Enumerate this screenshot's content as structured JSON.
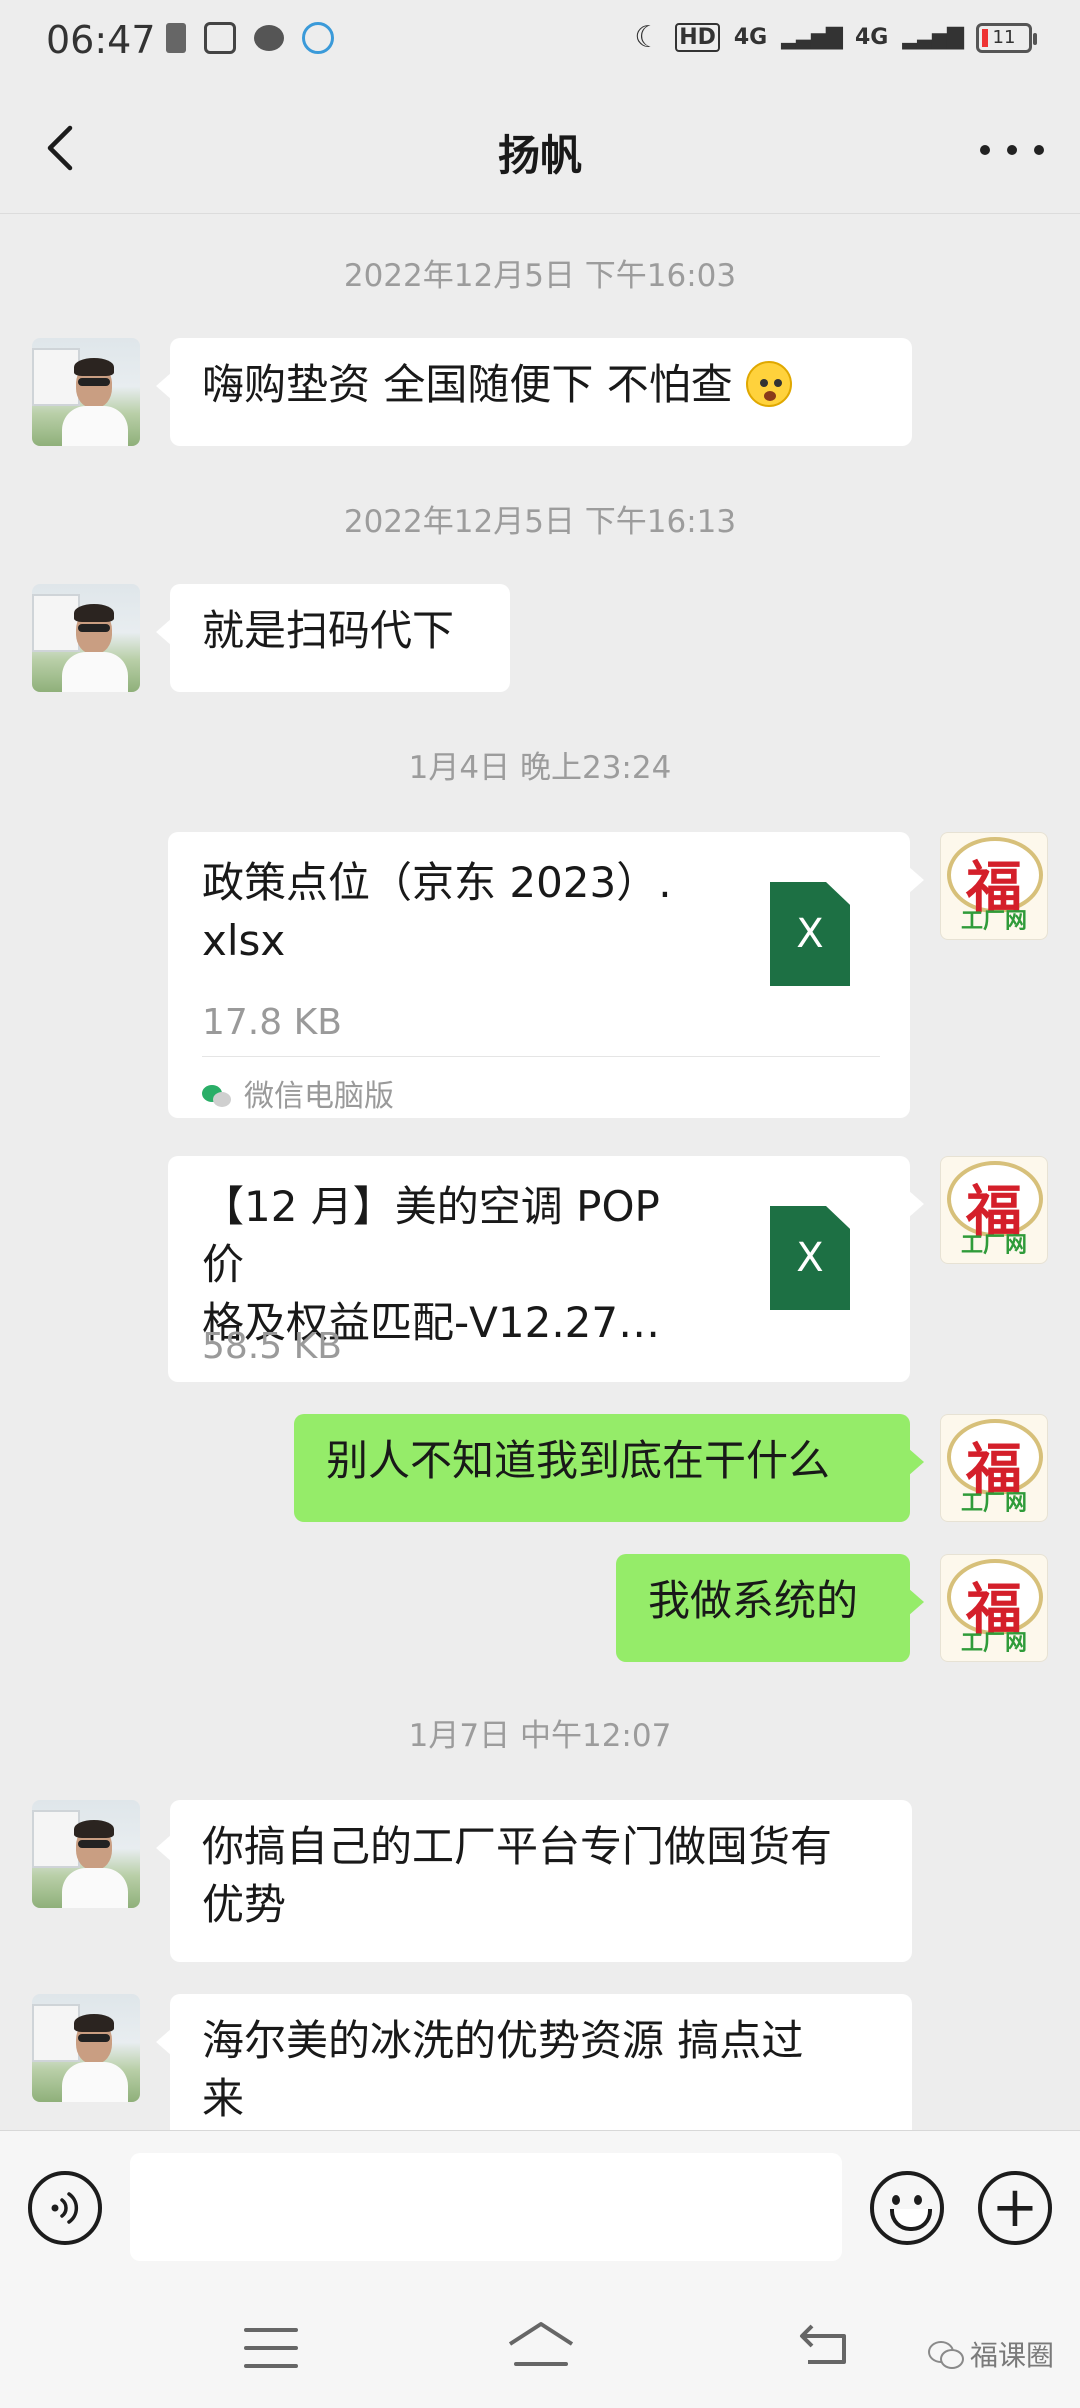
{
  "status_bar": {
    "time": "06:47",
    "hd_label": "HD",
    "network_1": "4G",
    "network_2": "4G",
    "battery": "11"
  },
  "header": {
    "title": "扬帆",
    "back_icon": "chevron-left-icon",
    "more_icon": "more-dots-icon"
  },
  "messages": {
    "ts_1": "2022年12月5日  下午16:03",
    "m1_text": "嗨购垫资  全国随便下  不怕查",
    "ts_2": "2022年12月5日  下午16:13",
    "m2_text": "就是扫码代下",
    "ts_3": "1月4日  晚上23:24",
    "file1": {
      "name_line1": "政策点位（京东 2023）.",
      "name_line2": "xlsx",
      "size": "17.8  KB",
      "icon_letter": "X",
      "source": "微信电脑版"
    },
    "file2": {
      "name_line1": "【12 月】美的空调 POP 价",
      "name_line2": "格及权益匹配-V12.27…",
      "size": "58.5  KB",
      "icon_letter": "X"
    },
    "m5_text": "别人不知道我到底在干什么",
    "m6_text": "我做系统的",
    "ts_4": "1月7日  中午12:07",
    "m7_line1": "你搞自己的工厂平台专门做囤货有",
    "m7_line2": "优势",
    "m8_line1": "海尔美的冰洗的优势资源  搞点过",
    "m8_line2": "来"
  },
  "avatar_logo": {
    "glyph": "福",
    "sub": "工厂网"
  },
  "input_bar": {
    "value": "",
    "voice_icon": "voice-icon",
    "emoji_icon": "emoji-icon",
    "plus_icon": "plus-icon"
  },
  "nav": {
    "watermark": "福课圈"
  }
}
